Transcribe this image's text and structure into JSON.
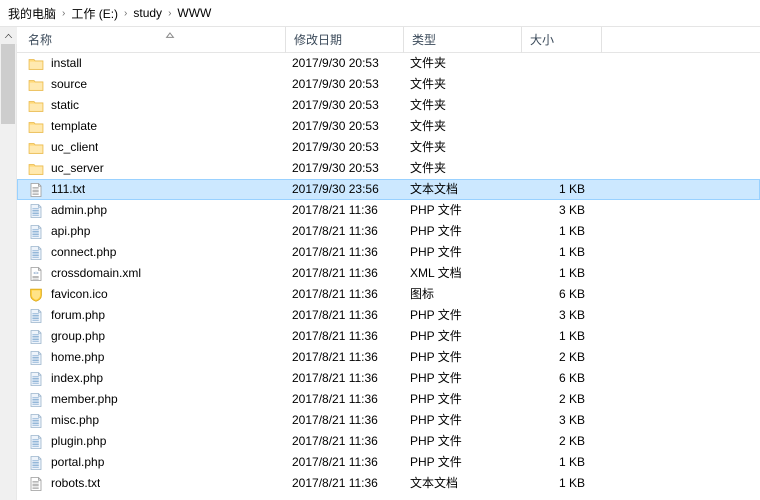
{
  "breadcrumb": {
    "separator": "›",
    "items": [
      {
        "label": "我的电脑"
      },
      {
        "label": "工作 (E:)"
      },
      {
        "label": "study"
      },
      {
        "label": "WWW"
      }
    ]
  },
  "columns": {
    "name": "名称",
    "date": "修改日期",
    "type": "类型",
    "size": "大小",
    "sort_icon": "sort-ascending-icon"
  },
  "colors": {
    "selection_fill": "#cce8ff",
    "selection_border": "#99d1ff",
    "header_text": "#3b4a5a",
    "folder_icon": "#ffd97a",
    "scrollbar_track": "#f0f0f0",
    "scrollbar_thumb": "#cdcdcd"
  },
  "rows": [
    {
      "name": "install",
      "date": "2017/9/30 20:53",
      "type": "文件夹",
      "size": "",
      "icon": "folder-icon",
      "selected": false
    },
    {
      "name": "source",
      "date": "2017/9/30 20:53",
      "type": "文件夹",
      "size": "",
      "icon": "folder-icon",
      "selected": false
    },
    {
      "name": "static",
      "date": "2017/9/30 20:53",
      "type": "文件夹",
      "size": "",
      "icon": "folder-icon",
      "selected": false
    },
    {
      "name": "template",
      "date": "2017/9/30 20:53",
      "type": "文件夹",
      "size": "",
      "icon": "folder-icon",
      "selected": false
    },
    {
      "name": "uc_client",
      "date": "2017/9/30 20:53",
      "type": "文件夹",
      "size": "",
      "icon": "folder-icon",
      "selected": false
    },
    {
      "name": "uc_server",
      "date": "2017/9/30 20:53",
      "type": "文件夹",
      "size": "",
      "icon": "folder-icon",
      "selected": false
    },
    {
      "name": "111.txt",
      "date": "2017/9/30 23:56",
      "type": "文本文档",
      "size": "1 KB",
      "icon": "text-file-icon",
      "selected": true
    },
    {
      "name": "admin.php",
      "date": "2017/8/21 11:36",
      "type": "PHP 文件",
      "size": "3 KB",
      "icon": "php-file-icon",
      "selected": false
    },
    {
      "name": "api.php",
      "date": "2017/8/21 11:36",
      "type": "PHP 文件",
      "size": "1 KB",
      "icon": "php-file-icon",
      "selected": false
    },
    {
      "name": "connect.php",
      "date": "2017/8/21 11:36",
      "type": "PHP 文件",
      "size": "1 KB",
      "icon": "php-file-icon",
      "selected": false
    },
    {
      "name": "crossdomain.xml",
      "date": "2017/8/21 11:36",
      "type": "XML 文档",
      "size": "1 KB",
      "icon": "xml-file-icon",
      "selected": false
    },
    {
      "name": "favicon.ico",
      "date": "2017/8/21 11:36",
      "type": "图标",
      "size": "6 KB",
      "icon": "icon-file-icon",
      "selected": false
    },
    {
      "name": "forum.php",
      "date": "2017/8/21 11:36",
      "type": "PHP 文件",
      "size": "3 KB",
      "icon": "php-file-icon",
      "selected": false
    },
    {
      "name": "group.php",
      "date": "2017/8/21 11:36",
      "type": "PHP 文件",
      "size": "1 KB",
      "icon": "php-file-icon",
      "selected": false
    },
    {
      "name": "home.php",
      "date": "2017/8/21 11:36",
      "type": "PHP 文件",
      "size": "2 KB",
      "icon": "php-file-icon",
      "selected": false
    },
    {
      "name": "index.php",
      "date": "2017/8/21 11:36",
      "type": "PHP 文件",
      "size": "6 KB",
      "icon": "php-file-icon",
      "selected": false
    },
    {
      "name": "member.php",
      "date": "2017/8/21 11:36",
      "type": "PHP 文件",
      "size": "2 KB",
      "icon": "php-file-icon",
      "selected": false
    },
    {
      "name": "misc.php",
      "date": "2017/8/21 11:36",
      "type": "PHP 文件",
      "size": "3 KB",
      "icon": "php-file-icon",
      "selected": false
    },
    {
      "name": "plugin.php",
      "date": "2017/8/21 11:36",
      "type": "PHP 文件",
      "size": "2 KB",
      "icon": "php-file-icon",
      "selected": false
    },
    {
      "name": "portal.php",
      "date": "2017/8/21 11:36",
      "type": "PHP 文件",
      "size": "1 KB",
      "icon": "php-file-icon",
      "selected": false
    },
    {
      "name": "robots.txt",
      "date": "2017/8/21 11:36",
      "type": "文本文档",
      "size": "1 KB",
      "icon": "text-file-icon",
      "selected": false
    }
  ]
}
